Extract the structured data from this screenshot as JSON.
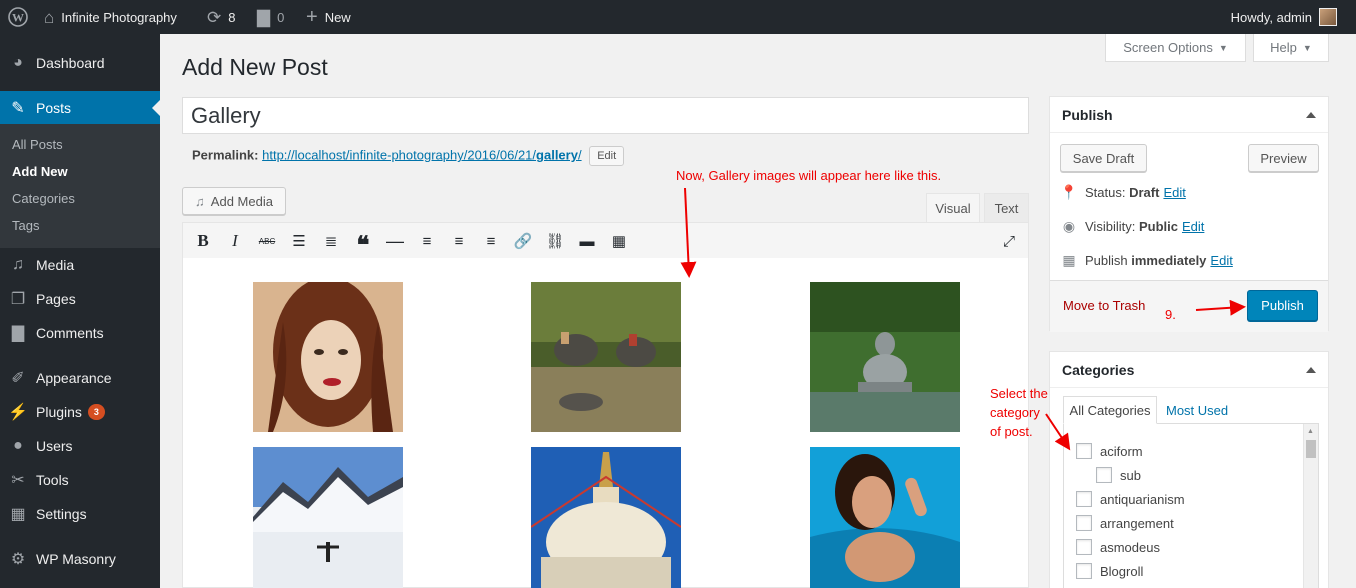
{
  "admin_bar": {
    "wp_logo": "wordpress-icon",
    "site_name": "Infinite Photography",
    "updates_count": "8",
    "comments_count": "0",
    "new_label": "New",
    "howdy": "Howdy, admin"
  },
  "sidebar": {
    "items": [
      {
        "label": "Dashboard",
        "icon": "dashboard-icon"
      },
      {
        "label": "Posts",
        "icon": "pin-icon"
      },
      {
        "label": "Media",
        "icon": "media-icon"
      },
      {
        "label": "Pages",
        "icon": "pages-icon"
      },
      {
        "label": "Comments",
        "icon": "comments-icon"
      },
      {
        "label": "Appearance",
        "icon": "appearance-icon"
      },
      {
        "label": "Plugins",
        "icon": "plugins-icon",
        "badge": "3"
      },
      {
        "label": "Users",
        "icon": "users-icon"
      },
      {
        "label": "Tools",
        "icon": "tools-icon"
      },
      {
        "label": "Settings",
        "icon": "settings-icon"
      },
      {
        "label": "WP Masonry",
        "icon": "gear-icon"
      }
    ],
    "posts_submenu": [
      "All Posts",
      "Add New",
      "Categories",
      "Tags"
    ]
  },
  "screen_options": "Screen Options",
  "help": "Help",
  "page_title": "Add New Post",
  "post": {
    "title": "Gallery",
    "permalink_label": "Permalink:",
    "permalink_base": "http://localhost/infinite-photography/2016/06/21/",
    "permalink_slug": "gallery",
    "permalink_end": "/",
    "edit_label": "Edit"
  },
  "editor": {
    "add_media": "Add Media",
    "tab_visual": "Visual",
    "tab_text": "Text",
    "toolbar": [
      "bold",
      "italic",
      "strikethrough",
      "bulleted-list",
      "numbered-list",
      "blockquote",
      "horizontal-line",
      "align-left",
      "align-center",
      "align-right",
      "insert-link",
      "remove-link",
      "read-more",
      "toolbar-toggle",
      "fullscreen"
    ]
  },
  "gallery_images": [
    {
      "name": "portrait-woman-image",
      "colors": [
        "#e8c9a8",
        "#7a3b22",
        "#2a150c"
      ]
    },
    {
      "name": "elephants-image",
      "colors": [
        "#5b6b33",
        "#8f8660",
        "#2e3a1b"
      ]
    },
    {
      "name": "buddha-statue-image",
      "colors": [
        "#4d7a3a",
        "#9ea7a8",
        "#2d4f22"
      ]
    },
    {
      "name": "snow-mountain-image",
      "colors": [
        "#7aa4d8",
        "#f2f4f7",
        "#d6dde6"
      ]
    },
    {
      "name": "stupa-image",
      "colors": [
        "#1f5fb5",
        "#e7dfc8",
        "#b3592a"
      ]
    },
    {
      "name": "pool-woman-image",
      "colors": [
        "#1aa3d9",
        "#d9a07e",
        "#0d6e9e"
      ]
    }
  ],
  "publish_box": {
    "title": "Publish",
    "save_draft": "Save Draft",
    "preview": "Preview",
    "status_label": "Status:",
    "status_value": "Draft",
    "visibility_label": "Visibility:",
    "visibility_value": "Public",
    "publish_label": "Publish",
    "publish_value": "immediately",
    "edit": "Edit",
    "trash": "Move to Trash",
    "publish_button": "Publish"
  },
  "categories_box": {
    "title": "Categories",
    "tab_all": "All Categories",
    "tab_used": "Most Used",
    "items": [
      {
        "label": "aciform",
        "indent": false
      },
      {
        "label": "sub",
        "indent": true
      },
      {
        "label": "antiquarianism",
        "indent": false
      },
      {
        "label": "arrangement",
        "indent": false
      },
      {
        "label": "asmodeus",
        "indent": false
      },
      {
        "label": "Blogroll",
        "indent": false
      }
    ]
  },
  "annotations": {
    "gallery_note": "Now, Gallery images will appear here like this.",
    "step": "9.",
    "category_note_1": "Select the",
    "category_note_2": "category",
    "category_note_3": "of post."
  },
  "colors": {
    "adminbar": "#23282d",
    "accent": "#0073aa",
    "publish_button": "#0085ba",
    "annotation": "#ee0000",
    "trash": "#a00000"
  }
}
